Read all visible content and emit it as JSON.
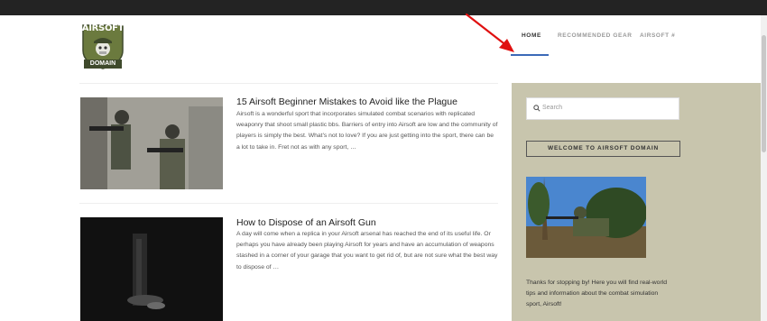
{
  "logo": {
    "top": "AIRSOFT",
    "bottom": "DOMAIN"
  },
  "nav": {
    "items": [
      {
        "label": "HOME"
      },
      {
        "label": "RECOMMENDED GEAR"
      },
      {
        "label": "AIRSOFT #"
      }
    ]
  },
  "posts": [
    {
      "title": "15 Airsoft Beginner Mistakes to Avoid like the Plague",
      "excerpt": "Airsoft is a wonderful sport that incorporates simulated combat scenarios with replicated weaponry that shoot small plastic bbs.  Barriers of entry into Airsoft are low and the community of players is simply the best. What's not to love? If you are just getting into the sport, there can be a lot to take in.  Fret not as with any sport, …"
    },
    {
      "title": "How to Dispose of an Airsoft Gun",
      "excerpt": "A day will come when a replica in your Airsoft arsenal has reached the end of its useful life.  Or perhaps you have already been playing Airsoft for years and have an accumulation of weapons stashed in a corner of your garage that you want to get rid of, but are not sure what the best way to dispose of …"
    }
  ],
  "sidebar": {
    "search_placeholder": "Search",
    "welcome_label": "WELCOME TO AIRSOFT DOMAIN",
    "intro_text": "Thanks for stopping by!  Here you will find real-world tips and information about the combat simulation sport, Airsoft!"
  },
  "colors": {
    "topbar": "#232323",
    "nav_active_underline": "#3b6ab8",
    "sidebar_bg": "#c8c5ad",
    "annotation_arrow": "#e01010"
  }
}
